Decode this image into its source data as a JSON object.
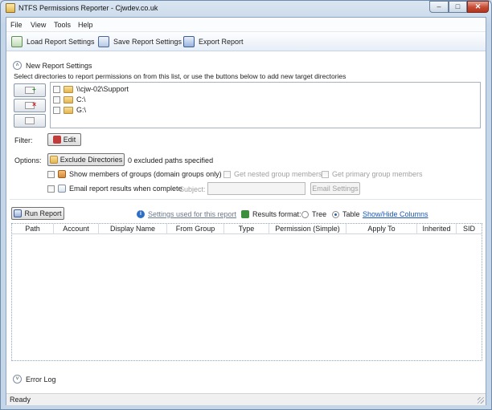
{
  "window": {
    "title": "NTFS Permissions Reporter - Cjwdev.co.uk",
    "controls": {
      "minimize": "–",
      "maximize": "□",
      "close": "✕"
    }
  },
  "menu": {
    "items": [
      "File",
      "View",
      "Tools",
      "Help"
    ]
  },
  "toolbar": {
    "load_label": "Load Report Settings",
    "save_label": "Save Report Settings",
    "export_label": "Export Report"
  },
  "new_report": {
    "heading": "New Report Settings",
    "instructions": "Select directories to report permissions on from this list, or use the buttons below to add new target directories",
    "directories": [
      "\\\\cjw-02\\Support",
      "C:\\",
      "G:\\"
    ]
  },
  "filter": {
    "label": "Filter:",
    "edit_label": "Edit"
  },
  "options": {
    "label": "Options:",
    "exclude_label": "Exclude Directories",
    "excluded_count_text": "0 excluded paths specified",
    "show_members_label": "Show members of groups  (domain groups only)",
    "nested_label": "Get nested group members",
    "primary_label": "Get primary group members",
    "email_label": "Email report results when complete",
    "subject_label": "Subject:",
    "subject_value": "",
    "email_settings_label": "Email Settings"
  },
  "run": {
    "run_label": "Run Report",
    "settings_link": "Settings used for this report",
    "format_label": "Results format:",
    "tree_label": "Tree",
    "table_label": "Table",
    "selected_format": "Table",
    "columns_link": "Show/Hide Columns"
  },
  "results_table": {
    "columns": [
      "Path",
      "Account",
      "Display Name",
      "From Group",
      "Type",
      "Permission (Simple)",
      "Apply To",
      "Inherited",
      "SID"
    ],
    "rows": []
  },
  "error_log": {
    "heading": "Error Log"
  },
  "status": {
    "text": "Ready"
  },
  "icons": {
    "collapse": "chevron-up-icon",
    "expand": "chevron-down-icon",
    "folder": "folder-icon",
    "info": "info-icon"
  }
}
